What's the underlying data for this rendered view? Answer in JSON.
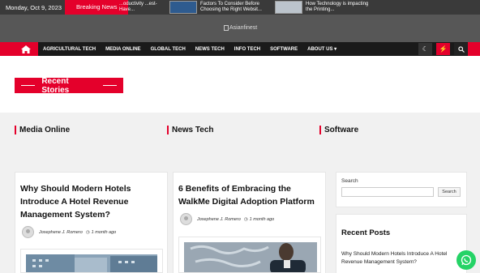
{
  "topbar": {
    "date": "Monday, Oct 9, 2023",
    "breaking_label": "Breaking News",
    "ticker": [
      {
        "text": "...oductivity\n...est-Have..."
      },
      {
        "text": "Factors To Consider Before Choosing the Right Websit..."
      },
      {
        "text": "How Technology is impacting the Printing..."
      }
    ]
  },
  "header": {
    "logo_alt": "Asianfinest"
  },
  "nav": {
    "items": [
      "AGRICULTURAL TECH",
      "MEDIA ONLINE",
      "GLOBAL TECH",
      "NEWS TECH",
      "INFO TECH",
      "SOFTWARE",
      "ABOUT US"
    ],
    "icons": [
      "home-icon",
      "moon-icon",
      "bolt-icon",
      "search-icon"
    ]
  },
  "recent": {
    "label": "Recent Stories"
  },
  "categories": [
    "Media Online",
    "News Tech",
    "Software"
  ],
  "cards": [
    {
      "title": "Why Should Modern Hotels Introduce A Hotel Revenue Management System?",
      "author": "Josephene J. Romero",
      "time": "1 month ago"
    },
    {
      "title": "6 Benefits of Embracing the WalkMe Digital Adoption Platform",
      "author": "Josephene J. Romero",
      "time": "1 month ago"
    }
  ],
  "sidebar": {
    "search_label": "Search",
    "search_button": "Search",
    "search_value": "",
    "recent_posts_title": "Recent Posts",
    "recent_posts": [
      "Why Should Modern Hotels Introduce A Hotel Revenue Management System?"
    ]
  },
  "colors": {
    "accent": "#e4002b",
    "nav_bg": "#1a1a1a",
    "header_bg": "#575757",
    "whatsapp": "#25d366"
  }
}
